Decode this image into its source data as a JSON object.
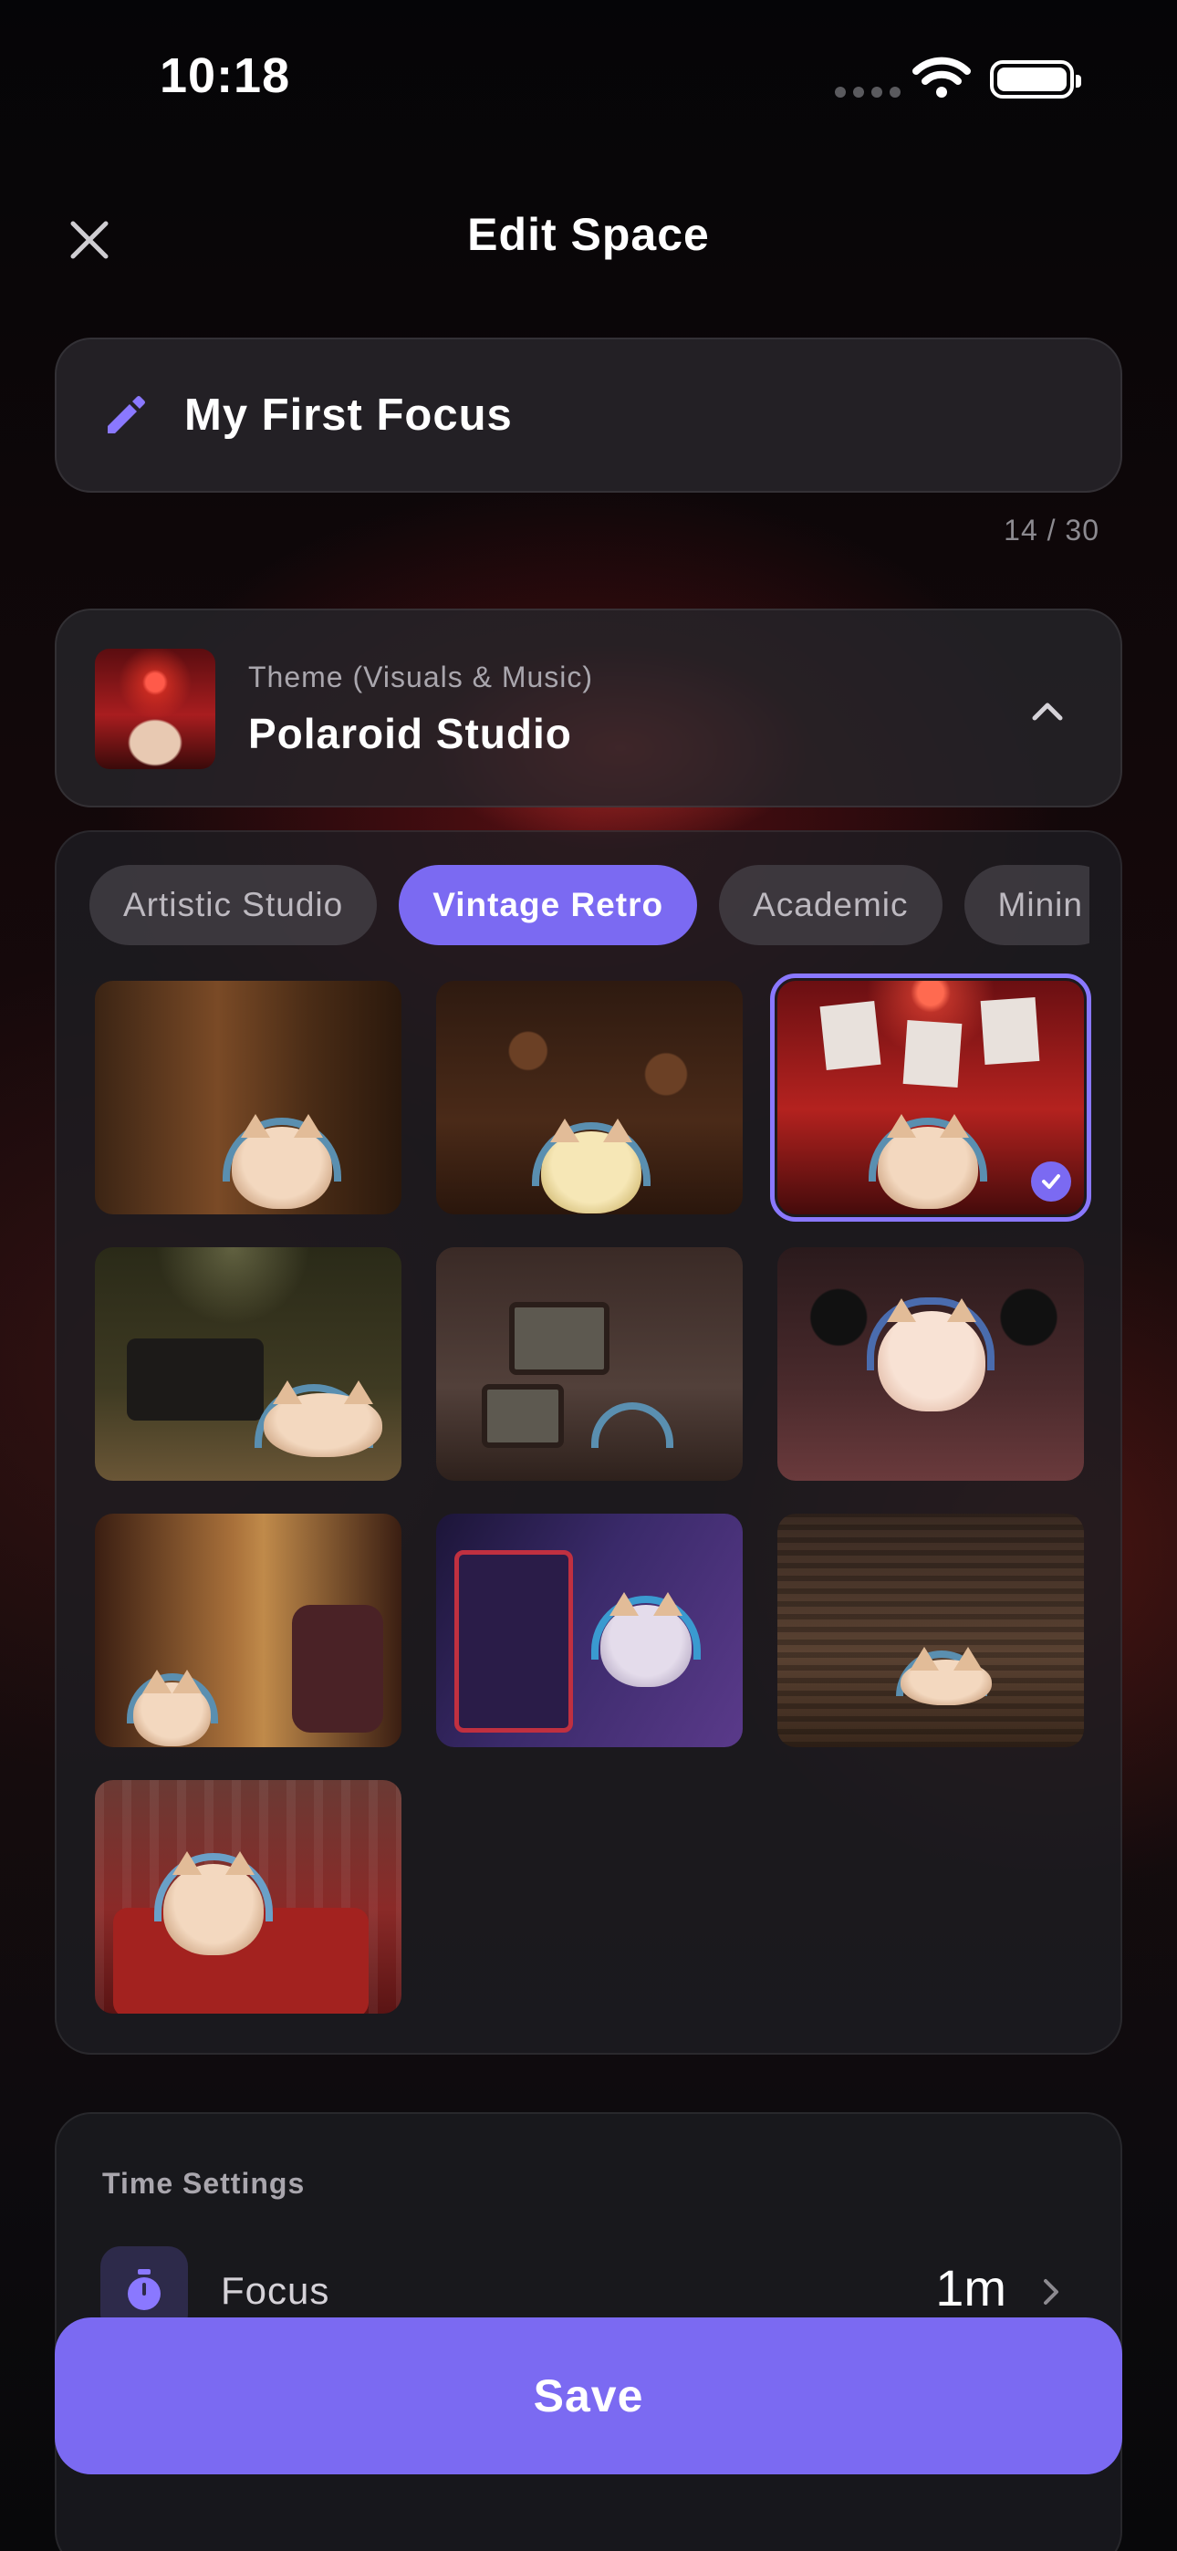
{
  "status_bar": {
    "time": "10:18"
  },
  "header": {
    "title": "Edit Space",
    "close_icon": "close-icon"
  },
  "name_field": {
    "value": "My First Focus",
    "char_count": "14 / 30",
    "icon": "pencil-icon"
  },
  "theme": {
    "label": "Theme (Visuals & Music)",
    "name": "Polaroid Studio",
    "expanded": true
  },
  "categories": [
    {
      "label": "Artistic Studio",
      "active": false
    },
    {
      "label": "Vintage Retro",
      "active": true
    },
    {
      "label": "Academic",
      "active": false
    },
    {
      "label": "Minin",
      "active": false
    }
  ],
  "theme_grid": {
    "count": 10,
    "selected_index": 2
  },
  "time_settings": {
    "title": "Time Settings",
    "focus_label": "Focus",
    "focus_value": "1m"
  },
  "save_label": "Save",
  "colors": {
    "accent": "#7b6af2",
    "background": "#0c0b0f",
    "card": "#26242a"
  }
}
